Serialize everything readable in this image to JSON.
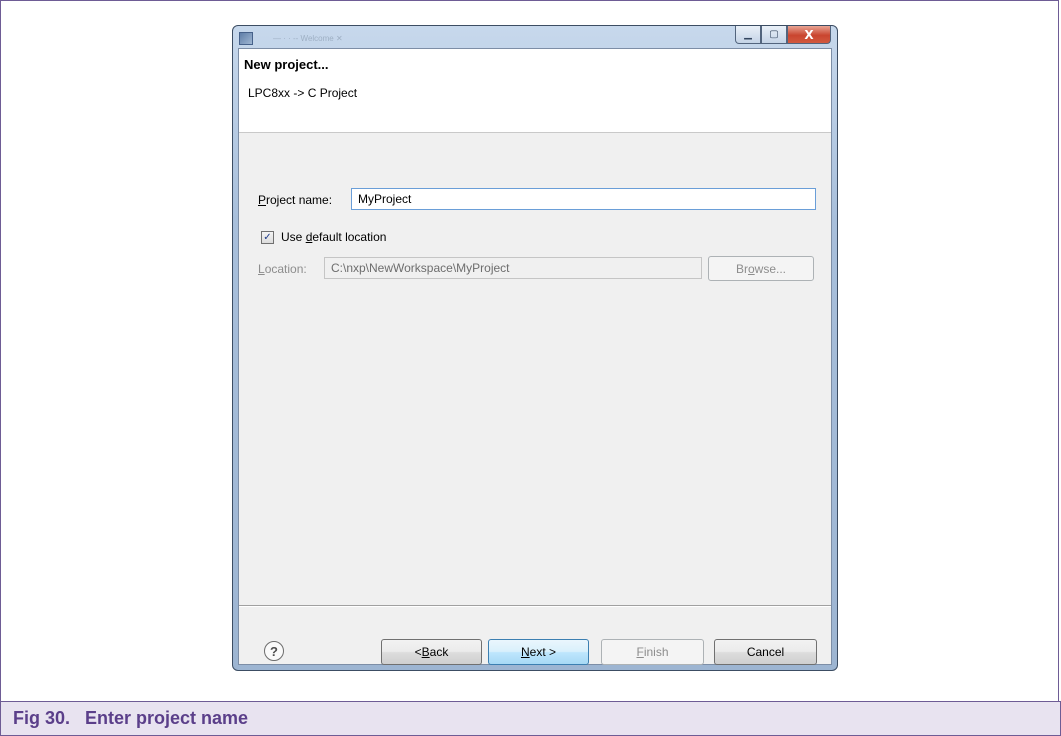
{
  "caption": "Fig 30.   Enter project name",
  "window": {
    "ghost_tabs": "— ·  ·   -- Welcome  ✕",
    "buttons": {
      "minimize": "▁",
      "maximize": "▢",
      "close": "X"
    }
  },
  "header": {
    "title": "New project...",
    "subtitle": "LPC8xx -> C Project"
  },
  "form": {
    "project_name_label_accel": "P",
    "project_name_label_rest": "roject name:",
    "project_name_value": "MyProject",
    "default_location_prefix": "Use ",
    "default_location_accel": "d",
    "default_location_rest": "efault location",
    "default_location_checked": true,
    "checkmark": "✓",
    "location_label_accel": "L",
    "location_label_rest": "ocation:",
    "location_value": "C:\\nxp\\NewWorkspace\\MyProject",
    "browse_accel": "o",
    "browse_pre": "Br",
    "browse_rest": "wse..."
  },
  "footer": {
    "help": "?",
    "back_pre": "< ",
    "back_accel": "B",
    "back_rest": "ack",
    "next_accel": "N",
    "next_rest": "ext >",
    "finish_accel": "F",
    "finish_rest": "inish",
    "cancel": "Cancel"
  }
}
